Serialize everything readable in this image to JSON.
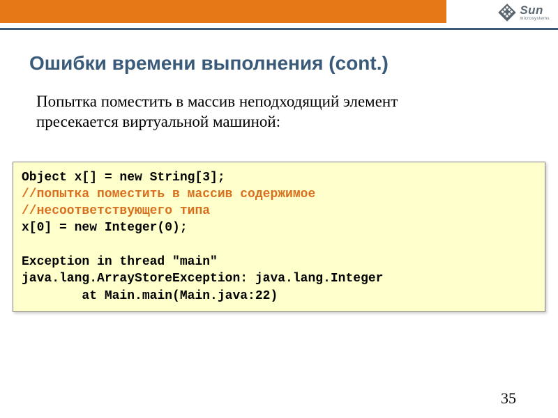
{
  "header": {
    "logo_main": "Sun",
    "logo_sub": "microsystems"
  },
  "slide": {
    "title": "Ошибки времени выполнения (cont.)",
    "body_line1": "Попытка поместить в массив неподходящий элемент",
    "body_line2": "пресекается виртуальной машиной:"
  },
  "code": {
    "line1": "Object x[] = new String[3];",
    "comment1": "//попытка поместить в массив содержимое",
    "comment2": "//несоответствующего типа",
    "line2": "x[0] = new Integer(0);",
    "blank": "",
    "line3": "Exception in thread \"main\"",
    "line4": "java.lang.ArrayStoreException: java.lang.Integer",
    "line5": "        at Main.main(Main.java:22)"
  },
  "page_number": "35"
}
